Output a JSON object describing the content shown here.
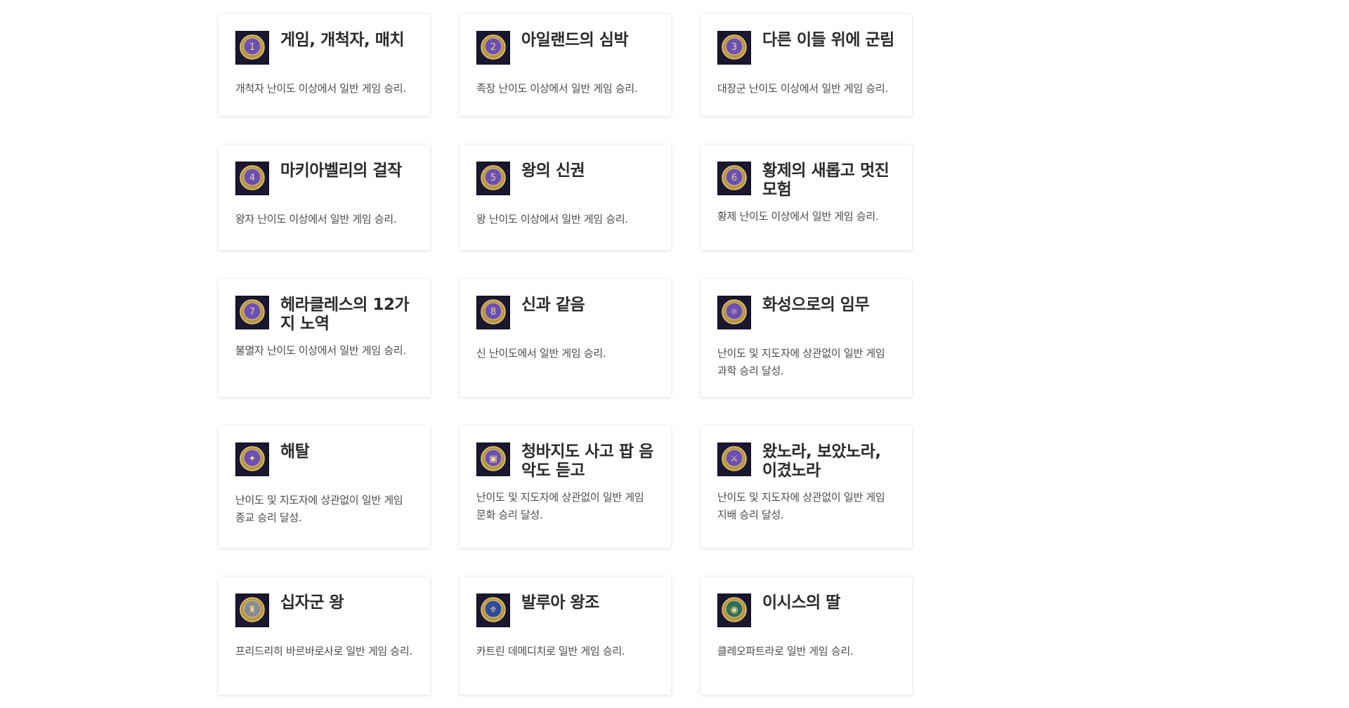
{
  "achievements": [
    {
      "title": "게임, 개척자, 매치",
      "desc": "개척자 난이도 이상에서 일반 게임 승리.",
      "icon": "medal-1-icon",
      "ring": "#6b4fb3",
      "glyph": "1"
    },
    {
      "title": "아일랜드의 심박",
      "desc": "족장 난이도 이상에서 일반 게임 승리.",
      "icon": "medal-2-icon",
      "ring": "#6b4fb3",
      "glyph": "2"
    },
    {
      "title": "다른 이들 위에 군림",
      "desc": "대장군 난이도 이상에서 일반 게임 승리.",
      "icon": "medal-3-icon",
      "ring": "#6b4fb3",
      "glyph": "3"
    },
    {
      "title": "마키아벨리의 걸작",
      "desc": "왕자 난이도 이상에서 일반 게임 승리.",
      "icon": "medal-4-icon",
      "ring": "#6b4fb3",
      "glyph": "4"
    },
    {
      "title": "왕의 신권",
      "desc": "왕 난이도 이상에서 일반 게임 승리.",
      "icon": "medal-5-icon",
      "ring": "#6b4fb3",
      "glyph": "5"
    },
    {
      "title": "황제의 새롭고 멋진 모험",
      "desc": "황제 난이도 이상에서 일반 게임 승리.",
      "icon": "medal-6-icon",
      "ring": "#6b4fb3",
      "glyph": "6"
    },
    {
      "title": "헤라클레스의 12가지 노역",
      "desc": "불멸자 난이도 이상에서 일반 게임 승리.",
      "icon": "medal-7-icon",
      "ring": "#6b4fb3",
      "glyph": "7"
    },
    {
      "title": "신과 같음",
      "desc": "신 난이도에서 일반 게임 승리.",
      "icon": "medal-8-icon",
      "ring": "#6b4fb3",
      "glyph": "8"
    },
    {
      "title": "화성으로의 임무",
      "desc": "난이도 및 지도자에 상관없이 일반 게임 과학 승리 달성.",
      "icon": "atom-icon",
      "ring": "#6b4fb3",
      "glyph": "⚛"
    },
    {
      "title": "해탈",
      "desc": "난이도 및 지도자에 상관없이 일반 게임 종교 승리 달성.",
      "icon": "religion-star-icon",
      "ring": "#6b4fb3",
      "glyph": "✦"
    },
    {
      "title": "청바지도 사고 팝 음악도 듣고",
      "desc": "난이도 및 지도자에 상관없이 일반 게임 문화 승리 달성.",
      "icon": "treasure-chest-icon",
      "ring": "#6b4fb3",
      "glyph": "▣"
    },
    {
      "title": "왔노라, 보았노라, 이겼노라",
      "desc": "난이도 및 지도자에 상관없이 일반 게임 지배 승리 달성.",
      "icon": "shield-sword-icon",
      "ring": "#6b4fb3",
      "glyph": "⚔"
    },
    {
      "title": "십자군 왕",
      "desc": "프리드리히 바르바로사로 일반 게임 승리.",
      "icon": "crusader-helmet-icon",
      "ring": "#8a8a96",
      "glyph": "♜"
    },
    {
      "title": "발루아 왕조",
      "desc": "카트린 데메디치로 일반 게임 승리.",
      "icon": "fleur-de-lis-icon",
      "ring": "#2e4a9c",
      "glyph": "⚜"
    },
    {
      "title": "이시스의 딸",
      "desc": "클레오파트라로 일반 게임 승리.",
      "icon": "eye-of-horus-icon",
      "ring": "#2f6f5a",
      "glyph": "◉"
    }
  ]
}
